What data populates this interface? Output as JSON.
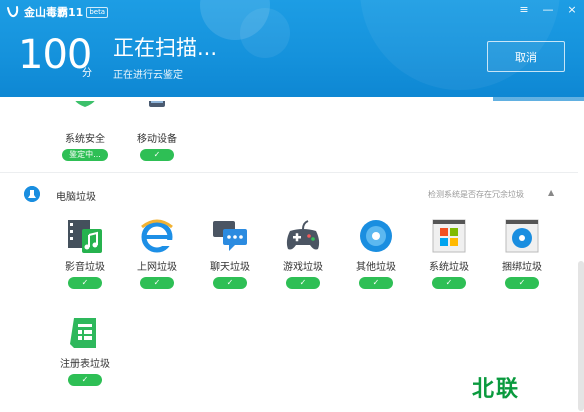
{
  "app": {
    "name": "金山毒霸11",
    "badge": "beta",
    "window_controls": [
      "≡",
      "—",
      "×"
    ]
  },
  "scan": {
    "score": "100",
    "score_unit": "分",
    "title": "正在扫描...",
    "subtitle": "正在进行云鉴定",
    "cancel_label": "取消",
    "progress": 0.845
  },
  "partial_items": [
    {
      "label": "系统安全",
      "status": "鉴定中...",
      "icon": "shield-icon"
    },
    {
      "label": "移动设备",
      "status": "✓",
      "icon": "phone-icon"
    }
  ],
  "junk_section": {
    "title": "电脑垃圾",
    "hint": "检测系统是否存在冗余垃圾",
    "collapse": "▲",
    "items": [
      {
        "label": "影音垃圾",
        "status": "✓",
        "icon": "media-icon"
      },
      {
        "label": "上网垃圾",
        "status": "✓",
        "icon": "ie-icon"
      },
      {
        "label": "聊天垃圾",
        "status": "✓",
        "icon": "chat-icon"
      },
      {
        "label": "游戏垃圾",
        "status": "✓",
        "icon": "gamepad-icon"
      },
      {
        "label": "其他垃圾",
        "status": "✓",
        "icon": "disc-icon"
      },
      {
        "label": "系统垃圾",
        "status": "✓",
        "icon": "windows-icon"
      },
      {
        "label": "捆绑垃圾",
        "status": "✓",
        "icon": "bundle-icon"
      },
      {
        "label": "注册表垃圾",
        "status": "✓",
        "icon": "registry-icon"
      }
    ]
  },
  "watermark": "北联",
  "colors": {
    "header_blue": "#1592dc",
    "success_green": "#2ebf55",
    "accent_blue": "#1a8ee0"
  }
}
